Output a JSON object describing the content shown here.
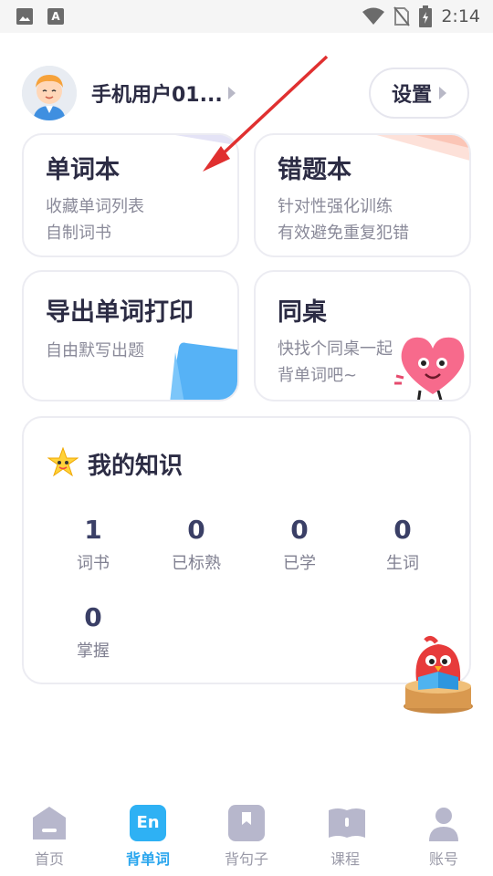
{
  "status_bar": {
    "left_icons": [
      "image-icon",
      "a-icon"
    ],
    "a_label": "A",
    "right_icons": [
      "wifi-icon",
      "no-sim-icon",
      "battery-icon"
    ],
    "time": "2:14"
  },
  "profile": {
    "username": "手机用户01...",
    "settings_label": "设置"
  },
  "cards": [
    {
      "title": "单词本",
      "lines": [
        "收藏单词列表",
        "自制词书"
      ]
    },
    {
      "title": "错题本",
      "lines": [
        "针对性强化训练",
        "有效避免重复犯错"
      ]
    },
    {
      "title": "导出单词打印",
      "lines": [
        "自由默写出题"
      ]
    },
    {
      "title": "同桌",
      "lines": [
        "快找个同桌一起",
        "背单词吧~"
      ]
    }
  ],
  "knowledge": {
    "title": "我的知识",
    "stats": [
      {
        "value": "1",
        "label": "词书"
      },
      {
        "value": "0",
        "label": "已标熟"
      },
      {
        "value": "0",
        "label": "已学"
      },
      {
        "value": "0",
        "label": "生词"
      },
      {
        "value": "0",
        "label": "掌握"
      }
    ]
  },
  "nav": {
    "items": [
      {
        "label": "首页",
        "icon": "home-icon"
      },
      {
        "label": "背单词",
        "icon": "en-icon",
        "badge": "En"
      },
      {
        "label": "背句子",
        "icon": "bookmark-icon"
      },
      {
        "label": "课程",
        "icon": "book-icon"
      },
      {
        "label": "账号",
        "icon": "person-icon"
      }
    ],
    "active_index": 1,
    "active_color": "#2eb1f4"
  }
}
